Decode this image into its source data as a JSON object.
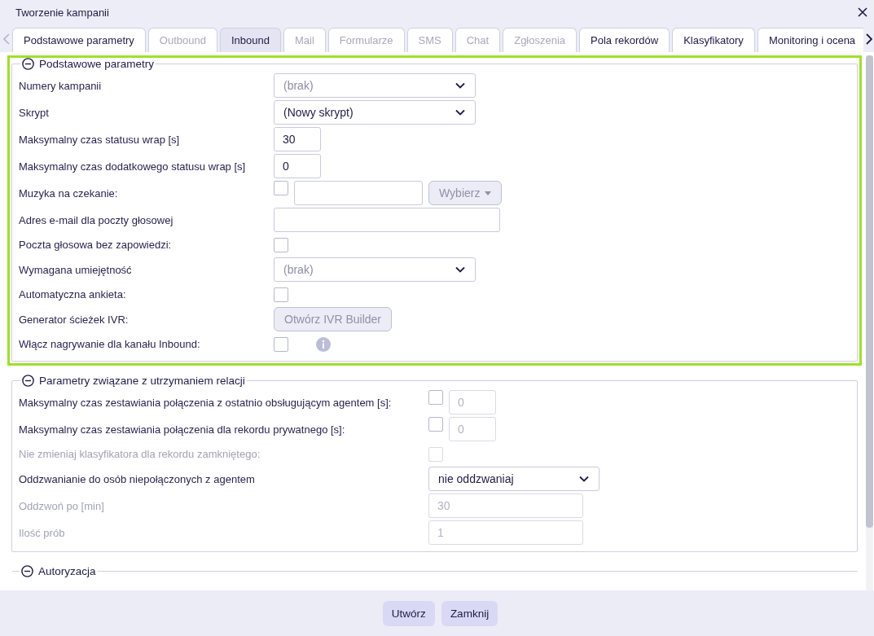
{
  "window": {
    "title": "Tworzenie kampanii"
  },
  "tabs": [
    {
      "label": "Podstawowe parametry",
      "selected": false,
      "disabled": false
    },
    {
      "label": "Outbound",
      "selected": false,
      "disabled": true
    },
    {
      "label": "Inbound",
      "selected": true,
      "disabled": false
    },
    {
      "label": "Mail",
      "selected": false,
      "disabled": true
    },
    {
      "label": "Formularze",
      "selected": false,
      "disabled": true
    },
    {
      "label": "SMS",
      "selected": false,
      "disabled": true
    },
    {
      "label": "Chat",
      "selected": false,
      "disabled": true
    },
    {
      "label": "Zgłoszenia",
      "selected": false,
      "disabled": true
    },
    {
      "label": "Pola rekordów",
      "selected": false,
      "disabled": false
    },
    {
      "label": "Klasyfikatory",
      "selected": false,
      "disabled": false
    },
    {
      "label": "Monitoring i ocena",
      "selected": false,
      "disabled": false
    }
  ],
  "sections": [
    {
      "title": "Podstawowe parametry",
      "expanded": true,
      "highlighted": true,
      "rows": [
        {
          "label": "Numery kampanii",
          "disabled": false,
          "controls": [
            {
              "kind": "select",
              "placeholder": "(brak)"
            }
          ]
        },
        {
          "label": "Skrypt",
          "disabled": false,
          "controls": [
            {
              "kind": "select",
              "value": "(Nowy skrypt)"
            }
          ]
        },
        {
          "label": "Maksymalny czas statusu wrap [s]",
          "disabled": false,
          "controls": [
            {
              "kind": "number",
              "value": "30",
              "disabled": false
            }
          ]
        },
        {
          "label": "Maksymalny czas dodatkowego statusu wrap [s]",
          "disabled": false,
          "controls": [
            {
              "kind": "number",
              "value": "0",
              "disabled": false
            }
          ]
        },
        {
          "label": "Muzyka na czekanie:",
          "disabled": false,
          "controls": [
            {
              "kind": "checkbox",
              "checked": false,
              "disabled": false
            },
            {
              "kind": "text",
              "disabled": false
            },
            {
              "kind": "dropdown-button",
              "label": "Wybierz",
              "disabled": true
            }
          ]
        },
        {
          "label": "Adres e-mail dla poczty głosowej",
          "disabled": false,
          "controls": [
            {
              "kind": "text",
              "disabled": false
            }
          ]
        },
        {
          "label": "Poczta głosowa bez zapowiedzi:",
          "disabled": false,
          "controls": [
            {
              "kind": "checkbox",
              "checked": false,
              "disabled": false
            }
          ]
        },
        {
          "label": "Wymagana umiejętność",
          "disabled": false,
          "controls": [
            {
              "kind": "select",
              "placeholder": "(brak)"
            }
          ]
        },
        {
          "label": "Automatyczna ankieta:",
          "disabled": false,
          "controls": [
            {
              "kind": "checkbox",
              "checked": false,
              "disabled": false
            }
          ]
        },
        {
          "label": "Generator ścieżek IVR:",
          "disabled": false,
          "controls": [
            {
              "kind": "button",
              "label": "Otwórz IVR Builder",
              "disabled": true
            }
          ]
        },
        {
          "label": "Włącz nagrywanie dla kanału Inbound:",
          "disabled": false,
          "controls": [
            {
              "kind": "checkbox",
              "checked": false,
              "disabled": false
            },
            {
              "kind": "info"
            }
          ]
        }
      ]
    },
    {
      "title": "Parametry związane z utrzymaniem relacji",
      "expanded": true,
      "highlighted": false,
      "rows": [
        {
          "label": "Maksymalny czas zestawiania połączenia z ostatnio obsługującym agentem [s]:",
          "disabled": false,
          "controls": [
            {
              "kind": "checkbox",
              "checked": false,
              "disabled": false
            },
            {
              "kind": "number",
              "value": "0",
              "disabled": true
            }
          ]
        },
        {
          "label": "Maksymalny czas zestawiania połączenia dla rekordu prywatnego [s]:",
          "disabled": false,
          "controls": [
            {
              "kind": "checkbox",
              "checked": false,
              "disabled": false
            },
            {
              "kind": "number",
              "value": "0",
              "disabled": true
            }
          ]
        },
        {
          "label": "Nie zmieniaj klasyfikatora dla rekordu zamkniętego:",
          "disabled": true,
          "controls": [
            {
              "kind": "checkbox",
              "checked": false,
              "disabled": true
            }
          ]
        },
        {
          "label": "Oddzwanianie do osób niepołączonych z agentem",
          "disabled": false,
          "controls": [
            {
              "kind": "select",
              "value": "nie oddzwaniaj"
            }
          ]
        },
        {
          "label": "Oddzwoń po [min]",
          "disabled": true,
          "controls": [
            {
              "kind": "text",
              "value": "30",
              "disabled": true
            }
          ]
        },
        {
          "label": "Ilość prób",
          "disabled": true,
          "controls": [
            {
              "kind": "text",
              "value": "1",
              "disabled": true
            }
          ]
        }
      ]
    },
    {
      "title": "Autoryzacja",
      "expanded": true,
      "highlighted": false
    }
  ],
  "buttons": [
    {
      "label": "Utwórz"
    },
    {
      "label": "Zamknij"
    }
  ]
}
